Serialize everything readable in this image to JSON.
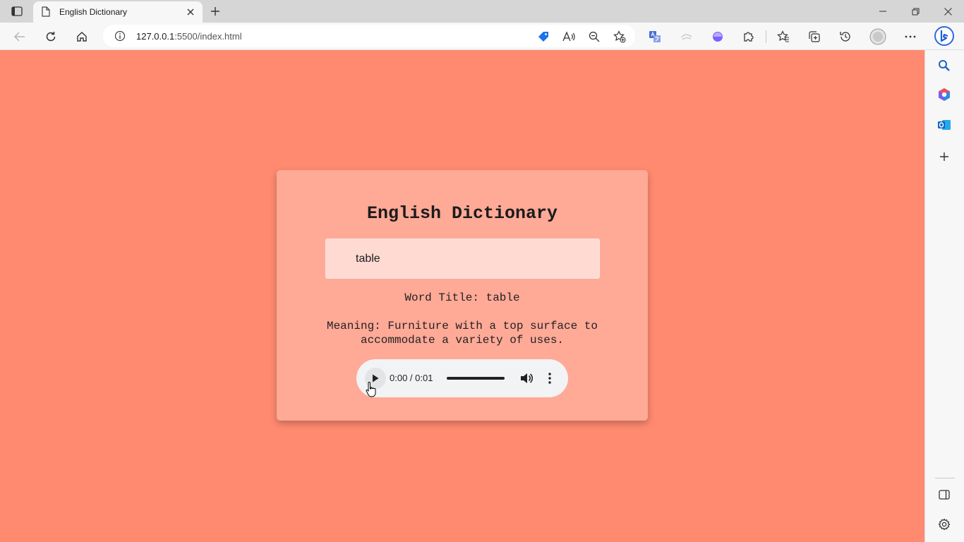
{
  "browser": {
    "tab": {
      "title": "English Dictionary"
    },
    "address_bar": {
      "url_host": "127.0.0.1",
      "url_rest": ":5500/index.html"
    }
  },
  "page": {
    "heading": "English Dictionary",
    "search_input": {
      "value": "table",
      "placeholder": ""
    },
    "word_title": "Word Title: table",
    "meaning_line1": "Meaning: Furniture with a top surface to",
    "meaning_line2": "accommodate a variety of uses.",
    "audio": {
      "time": "0:00 / 0:01",
      "progress": 0
    }
  },
  "colors": {
    "page_bg": "#ff8a70",
    "card_bg": "#ffa997",
    "input_bg": "#ffdad3",
    "audio_bg": "#f1f3f4"
  },
  "icons": {
    "tab_actions": "tab-actions-icon",
    "page": "page-icon",
    "close": "close-icon",
    "new_tab": "plus-icon",
    "back": "back-arrow-icon",
    "refresh": "refresh-icon",
    "home": "home-icon",
    "info": "info-icon",
    "shopping": "tag-icon",
    "read_aloud": "read-aloud-icon",
    "zoom_out": "zoom-out-icon",
    "favorite_add": "star-plus-icon",
    "translate": "translate-icon",
    "extensions": "puzzle-icon",
    "favorites": "favorites-icon",
    "collections": "collections-icon",
    "history": "history-icon",
    "profile": "avatar-icon",
    "menu": "more-icon",
    "bing": "bing-icon",
    "sidebar_search": "search-icon",
    "sidebar_office": "office-icon",
    "sidebar_outlook": "outlook-icon",
    "sidebar_add": "plus-icon",
    "sidebar_hide": "sidebar-panel-icon",
    "settings": "gear-icon"
  }
}
